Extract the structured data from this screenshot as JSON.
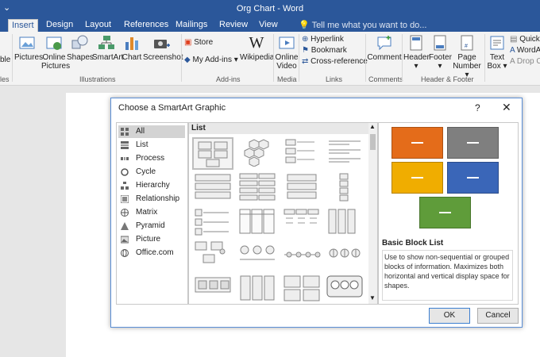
{
  "window": {
    "title": "Org Chart - Word"
  },
  "tabs": [
    {
      "label": "Insert"
    },
    {
      "label": "Design"
    },
    {
      "label": "Layout"
    },
    {
      "label": "References"
    },
    {
      "label": "Mailings"
    },
    {
      "label": "Review"
    },
    {
      "label": "View"
    }
  ],
  "tell_me": "Tell me what you want to do...",
  "ribbon": {
    "pictures": "Pictures",
    "online_pictures_1": "Online",
    "online_pictures_2": "Pictures",
    "shapes": "Shapes",
    "smartart": "SmartArt",
    "chart": "Chart",
    "screenshot": "Screenshot",
    "illustrations": "Illustrations",
    "store": "Store",
    "my_addins": "My Add-ins",
    "wikipedia": "Wikipedia",
    "addins": "Add-ins",
    "online_video_1": "Online",
    "online_video_2": "Video",
    "media": "Media",
    "hyperlink": "Hyperlink",
    "bookmark": "Bookmark",
    "crossref": "Cross-reference",
    "links": "Links",
    "comment": "Comment",
    "comments": "Comments",
    "header": "Header",
    "footer": "Footer",
    "page_1": "Page",
    "page_2": "Number",
    "header_footer": "Header & Footer",
    "textbox_1": "Text",
    "textbox_2": "Box",
    "quick": "Quick",
    "wordart": "WordA",
    "dropcap": "Drop C",
    "left_cut": "ble",
    "left_grp": "les"
  },
  "dialog": {
    "title": "Choose a SmartArt Graphic",
    "help": "?",
    "close": "✕",
    "categories": [
      "All",
      "List",
      "Process",
      "Cycle",
      "Hierarchy",
      "Relationship",
      "Matrix",
      "Pyramid",
      "Picture",
      "Office.com"
    ],
    "gallery_header": "List",
    "preview_title": "Basic Block List",
    "preview_desc": "Use to show non-sequential or grouped blocks of information. Maximizes both horizontal and vertical display space for shapes.",
    "ok": "OK",
    "cancel": "Cancel",
    "colors": {
      "orange": "#e46c1a",
      "gray": "#7f7f7f",
      "gold": "#f0ad00",
      "blue": "#3a66b8",
      "green": "#5f9c3a"
    }
  }
}
